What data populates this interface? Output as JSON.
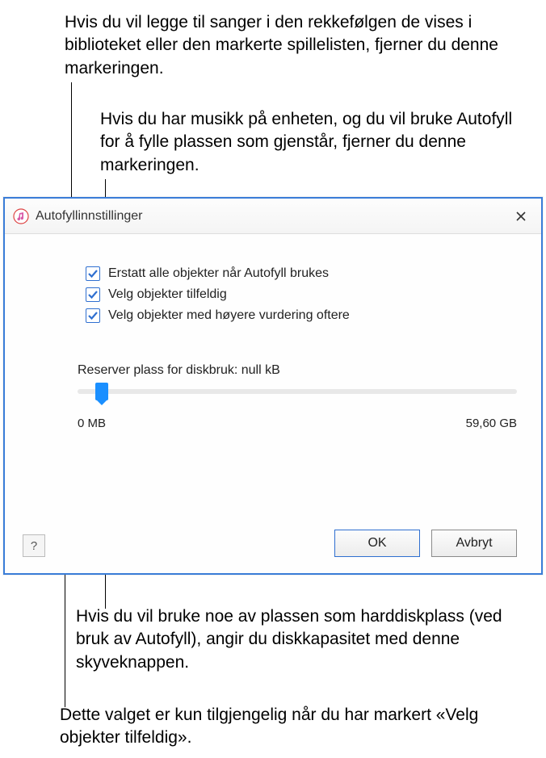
{
  "annotations": {
    "a1": "Hvis du vil legge til sanger i den rekkefølgen de vises i biblioteket eller den markerte spillelisten, fjerner du denne markeringen.",
    "a2": "Hvis du har musikk på enheten, og du vil bruke Autofyll for å fylle plassen som gjenstår, fjerner du denne markeringen.",
    "a3": "Hvis du vil bruke noe av plassen som harddiskplass (ved bruk av Autofyll), angir du diskkapasitet med denne skyveknappen.",
    "a4": "Dette valget er kun tilgjengelig når du har markert «Velg objekter tilfeldig»."
  },
  "dialog": {
    "title": "Autofyllinnstillinger",
    "checkboxes": {
      "replace_all": "Erstatt alle objekter når Autofyll brukes",
      "random": "Velg objekter tilfeldig",
      "higher_rating": "Velg objekter med høyere vurdering oftere"
    },
    "slider": {
      "label": "Reserver plass for diskbruk: null kB",
      "min_label": "0 MB",
      "max_label": "59,60 GB"
    },
    "buttons": {
      "ok": "OK",
      "cancel": "Avbryt",
      "help": "?"
    }
  }
}
